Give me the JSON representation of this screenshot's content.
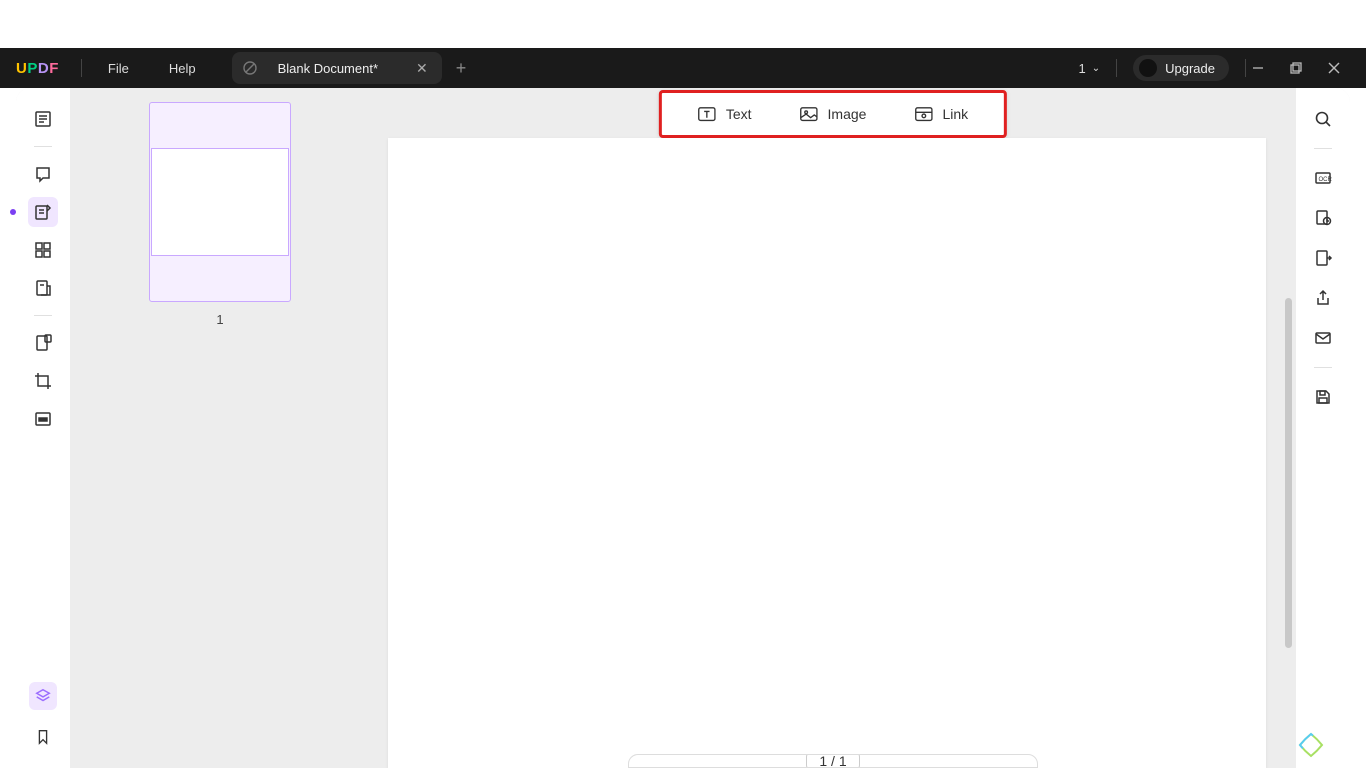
{
  "app": {
    "logo": "UPDF"
  },
  "menu": {
    "file": "File",
    "help": "Help"
  },
  "tab": {
    "title": "Blank Document*"
  },
  "header": {
    "count": "1",
    "upgrade": "Upgrade"
  },
  "edit_toolbar": {
    "text": "Text",
    "image": "Image",
    "link": "Link"
  },
  "thumbnails": {
    "page1": "1"
  },
  "footer": {
    "page_indicator": "1 / 1"
  }
}
